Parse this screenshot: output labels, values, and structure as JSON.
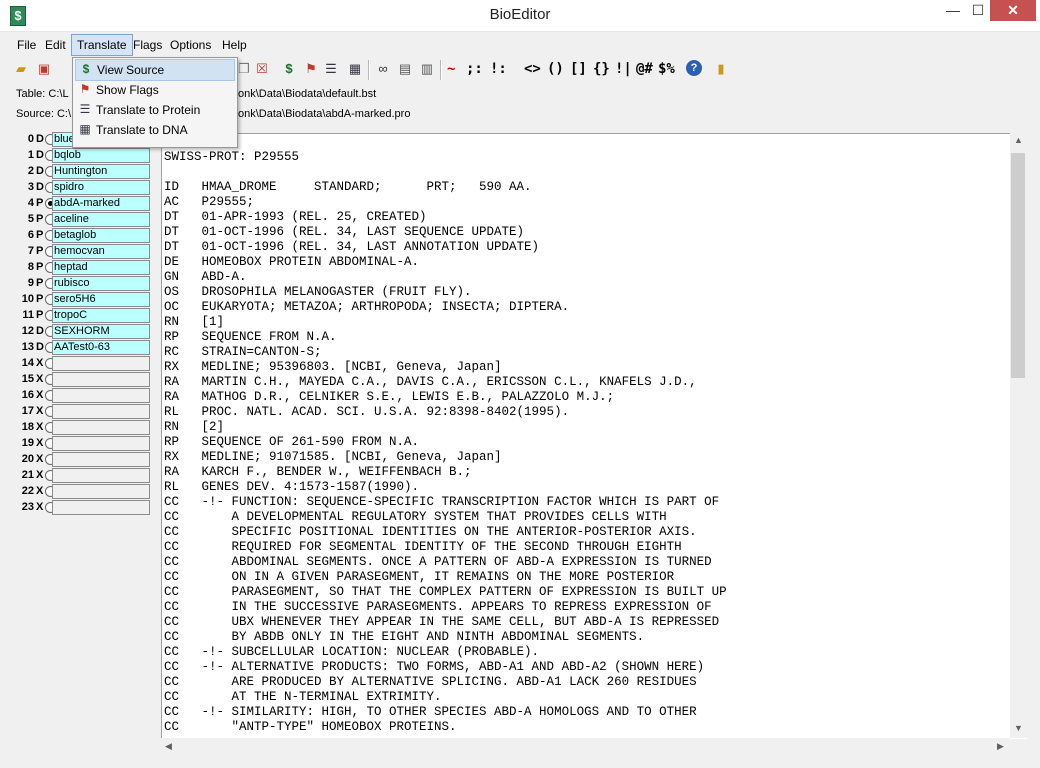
{
  "window": {
    "title": "BioEditor",
    "min": "—",
    "max": "☐",
    "close": "✕"
  },
  "menu": [
    "File",
    "Edit",
    "Translate",
    "Flags",
    "Options",
    "Help"
  ],
  "toolbar": {
    "symbols": [
      "~",
      ";:",
      "!:",
      "<>",
      "()",
      "[]",
      "{}",
      "!|",
      "@#",
      "$%",
      "?"
    ]
  },
  "info": {
    "table_label": "Table: C:\\L",
    "table_path": "onk\\Data\\Biodata\\default.bst",
    "source_label": "Source: C:\\",
    "source_path": "onk\\Data\\Biodata\\abdA-marked.pro"
  },
  "dropdown": [
    {
      "label": "View Source",
      "icon": "dollar-s-icon"
    },
    {
      "label": "Show Flags",
      "icon": "flag-icon"
    },
    {
      "label": "Translate to Protein",
      "icon": "protein-list-icon"
    },
    {
      "label": "Translate to DNA",
      "icon": "dna-grid-icon"
    }
  ],
  "sequences": [
    {
      "idx": "0",
      "type": "D",
      "name": "blue",
      "selected": false
    },
    {
      "idx": "1",
      "type": "D",
      "name": "bqlob",
      "selected": false
    },
    {
      "idx": "2",
      "type": "D",
      "name": "Huntington",
      "selected": false
    },
    {
      "idx": "3",
      "type": "D",
      "name": "spidro",
      "selected": false
    },
    {
      "idx": "4",
      "type": "P",
      "name": "abdA-marked",
      "selected": true
    },
    {
      "idx": "5",
      "type": "P",
      "name": "aceline",
      "selected": false
    },
    {
      "idx": "6",
      "type": "P",
      "name": "betaglob",
      "selected": false
    },
    {
      "idx": "7",
      "type": "P",
      "name": "hemocvan",
      "selected": false
    },
    {
      "idx": "8",
      "type": "P",
      "name": "heptad",
      "selected": false
    },
    {
      "idx": "9",
      "type": "P",
      "name": "rubisco",
      "selected": false
    },
    {
      "idx": "10",
      "type": "P",
      "name": "sero5H6",
      "selected": false
    },
    {
      "idx": "11",
      "type": "P",
      "name": "tropoC",
      "selected": false
    },
    {
      "idx": "12",
      "type": "D",
      "name": "SEXHORM",
      "selected": false
    },
    {
      "idx": "13",
      "type": "D",
      "name": "AATest0-63",
      "selected": false
    },
    {
      "idx": "14",
      "type": "X",
      "name": "",
      "selected": false
    },
    {
      "idx": "15",
      "type": "X",
      "name": "",
      "selected": false
    },
    {
      "idx": "16",
      "type": "X",
      "name": "",
      "selected": false
    },
    {
      "idx": "17",
      "type": "X",
      "name": "",
      "selected": false
    },
    {
      "idx": "18",
      "type": "X",
      "name": "",
      "selected": false
    },
    {
      "idx": "19",
      "type": "X",
      "name": "",
      "selected": false
    },
    {
      "idx": "20",
      "type": "X",
      "name": "",
      "selected": false
    },
    {
      "idx": "21",
      "type": "X",
      "name": "",
      "selected": false
    },
    {
      "idx": "22",
      "type": "X",
      "name": "",
      "selected": false
    },
    {
      "idx": "23",
      "type": "X",
      "name": "",
      "selected": false
    }
  ],
  "document": [
    "SWISS-PROT: P29555",
    "",
    "ID   HMAA_DROME     STANDARD;      PRT;   590 AA.",
    "AC   P29555;",
    "DT   01-APR-1993 (REL. 25, CREATED)",
    "DT   01-OCT-1996 (REL. 34, LAST SEQUENCE UPDATE)",
    "DT   01-OCT-1996 (REL. 34, LAST ANNOTATION UPDATE)",
    "DE   HOMEOBOX PROTEIN ABDOMINAL-A.",
    "GN   ABD-A.",
    "OS   DROSOPHILA MELANOGASTER (FRUIT FLY).",
    "OC   EUKARYOTA; METAZOA; ARTHROPODA; INSECTA; DIPTERA.",
    "RN   [1]",
    "RP   SEQUENCE FROM N.A.",
    "RC   STRAIN=CANTON-S;",
    "RX   MEDLINE; 95396803. [NCBI, Geneva, Japan]",
    "RA   MARTIN C.H., MAYEDA C.A., DAVIS C.A., ERICSSON C.L., KNAFELS J.D.,",
    "RA   MATHOG D.R., CELNIKER S.E., LEWIS E.B., PALAZZOLO M.J.;",
    "RL   PROC. NATL. ACAD. SCI. U.S.A. 92:8398-8402(1995).",
    "RN   [2]",
    "RP   SEQUENCE OF 261-590 FROM N.A.",
    "RX   MEDLINE; 91071585. [NCBI, Geneva, Japan]",
    "RA   KARCH F., BENDER W., WEIFFENBACH B.;",
    "RL   GENES DEV. 4:1573-1587(1990).",
    "CC   -!- FUNCTION: SEQUENCE-SPECIFIC TRANSCRIPTION FACTOR WHICH IS PART OF",
    "CC       A DEVELOPMENTAL REGULATORY SYSTEM THAT PROVIDES CELLS WITH",
    "CC       SPECIFIC POSITIONAL IDENTITIES ON THE ANTERIOR-POSTERIOR AXIS.",
    "CC       REQUIRED FOR SEGMENTAL IDENTITY OF THE SECOND THROUGH EIGHTH",
    "CC       ABDOMINAL SEGMENTS. ONCE A PATTERN OF ABD-A EXPRESSION IS TURNED",
    "CC       ON IN A GIVEN PARASEGMENT, IT REMAINS ON THE MORE POSTERIOR",
    "CC       PARASEGMENT, SO THAT THE COMPLEX PATTERN OF EXPRESSION IS BUILT UP",
    "CC       IN THE SUCCESSIVE PARASEGMENTS. APPEARS TO REPRESS EXPRESSION OF",
    "CC       UBX WHENEVER THEY APPEAR IN THE SAME CELL, BUT ABD-A IS REPRESSED",
    "CC       BY ABDB ONLY IN THE EIGHT AND NINTH ABDOMINAL SEGMENTS.",
    "CC   -!- SUBCELLULAR LOCATION: NUCLEAR (PROBABLE).",
    "CC   -!- ALTERNATIVE PRODUCTS: TWO FORMS, ABD-A1 AND ABD-A2 (SHOWN HERE)",
    "CC       ARE PRODUCED BY ALTERNATIVE SPLICING. ABD-A1 LACK 260 RESIDUES",
    "CC       AT THE N-TERMINAL EXTRIMITY.",
    "CC   -!- SIMILARITY: HIGH, TO OTHER SPECIES ABD-A HOMOLOGS AND TO OTHER",
    "CC       \"ANTP-TYPE\" HOMEOBOX PROTEINS."
  ]
}
